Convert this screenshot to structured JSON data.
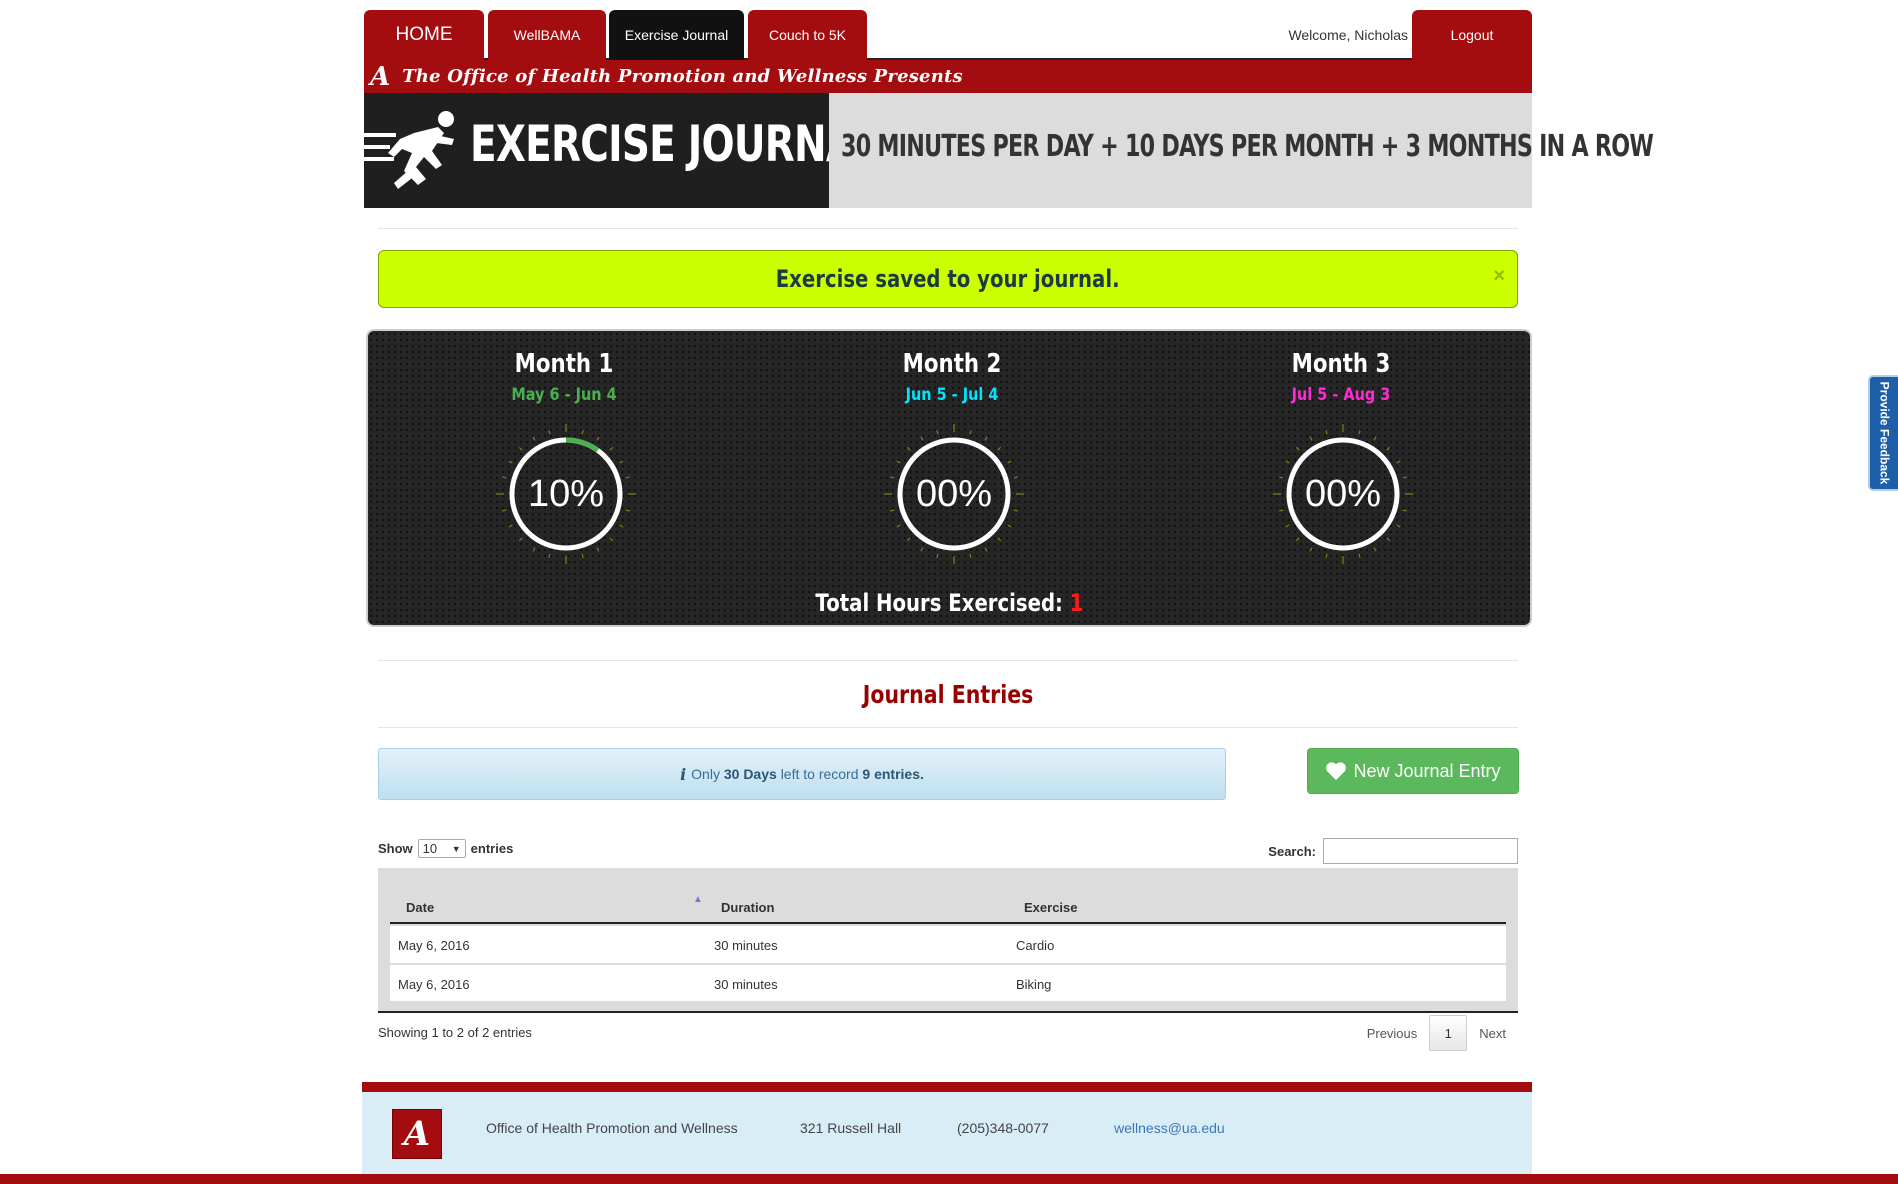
{
  "nav": {
    "home": "HOME",
    "wellbama": "WellBAMA",
    "exercise_journal": "Exercise Journal",
    "couch_to_5k": "Couch to 5K",
    "welcome": "Welcome, Nicholas",
    "logout": "Logout"
  },
  "strip": {
    "logo_letter": "A",
    "presents": "The Office of Health Promotion and Wellness  Presents"
  },
  "banner": {
    "title": "EXERCISE JOURNAL",
    "slogan": "30 MINUTES PER DAY + 10 DAYS PER MONTH + 3 MONTHS IN A ROW"
  },
  "alert": {
    "message": "Exercise saved to your journal.",
    "close": "×"
  },
  "months": [
    {
      "name": "Month 1",
      "range": "May 6 - Jun 4",
      "percent_label": "10%",
      "progress": 0.1,
      "range_color": "#4caf50"
    },
    {
      "name": "Month 2",
      "range": "Jun 5 - Jul 4",
      "percent_label": "00%",
      "progress": 0.0,
      "range_color": "#00e5ff"
    },
    {
      "name": "Month 3",
      "range": "Jul 5 - Aug 3",
      "percent_label": "00%",
      "progress": 0.0,
      "range_color": "#ff2ad4"
    }
  ],
  "gauge_progress_color": "#4caf50",
  "total": {
    "label": "Total Hours Exercised:",
    "value": "1"
  },
  "journal": {
    "title": "Journal Entries",
    "info_pre": "Only",
    "info_days": "30 Days",
    "info_mid": "left to record",
    "info_entries": "9 entries.",
    "new_entry": "New Journal Entry",
    "show_label": "Show",
    "show_value": "10",
    "entries_label": "entries",
    "search_label": "Search:",
    "columns": [
      "Date",
      "Duration",
      "Exercise"
    ],
    "rows": [
      {
        "date": "May 6, 2016",
        "duration": "30 minutes",
        "exercise": "Cardio"
      },
      {
        "date": "May 6, 2016",
        "duration": "30 minutes",
        "exercise": "Biking"
      }
    ],
    "showing": "Showing 1 to 2 of 2 entries",
    "previous": "Previous",
    "page": "1",
    "next": "Next"
  },
  "footer": {
    "logo_letter": "A",
    "org": "Office of Health Promotion and Wellness",
    "address": "321 Russell Hall",
    "phone": "(205)348-0077",
    "email": "wellness@ua.edu"
  },
  "feedback": "Provide Feedback"
}
